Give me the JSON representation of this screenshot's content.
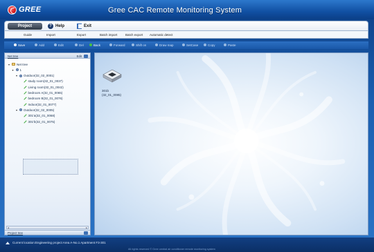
{
  "brand": {
    "logo_text": "GREE"
  },
  "window": {
    "title": "Gree CAC Remote Monitoring System"
  },
  "menubar": {
    "project": "Project",
    "help": "Help",
    "exit": "Exit"
  },
  "subbar": {
    "items": [
      "Guide",
      "Import",
      "Export",
      "Batch import",
      "Batch export",
      "Automatic detect"
    ]
  },
  "actionbar": {
    "items": [
      "Save",
      "Add",
      "Edit",
      "Del",
      "Back",
      "Forward",
      "Shift on",
      "Draw map",
      "SetCase",
      "Copy",
      "Paste"
    ]
  },
  "left_panel": {
    "header": "Net tree",
    "header_right": "Edit",
    "footer": "Project tree",
    "tree": [
      {
        "label": "Net tree",
        "level": 0,
        "icon": "folder",
        "twisty": "-"
      },
      {
        "label": "1",
        "level": 1,
        "icon": "node",
        "twisty": "-"
      },
      {
        "label": "Outdoor(32_02_0001)",
        "level": 2,
        "icon": "node",
        "twisty": "-"
      },
      {
        "label": "study room(32_01_0037)",
        "level": 3,
        "icon": "unit",
        "twisty": ""
      },
      {
        "label": "Living room(32_01_0042)",
        "level": 3,
        "icon": "unit",
        "twisty": ""
      },
      {
        "label": "bedroom A(32_01_0065)",
        "level": 3,
        "icon": "unit",
        "twisty": ""
      },
      {
        "label": "bedroom B(32_01_0076)",
        "level": 3,
        "icon": "unit",
        "twisty": ""
      },
      {
        "label": "Indoor(32_01_0077)",
        "level": 3,
        "icon": "unit",
        "twisty": ""
      },
      {
        "label": "Outdoor(32_02_0005)",
        "level": 2,
        "icon": "node",
        "twisty": "-"
      },
      {
        "label": "301'a(32_01_0068)",
        "level": 3,
        "icon": "unit",
        "twisty": ""
      },
      {
        "label": "301'b(32_01_0075)",
        "level": 3,
        "icon": "unit",
        "twisty": ""
      }
    ]
  },
  "workspace": {
    "device": {
      "name": "301b",
      "code": "(32_01_0085)"
    }
  },
  "status": {
    "location": "Current location:Engineering project Area A-No.1 Apartment F3-301",
    "copyright": "All rights reserved © Gree central air conditioner remote monitoring system"
  },
  "colors": {
    "title_bar": "#1150a3",
    "accent": "#2c6fc2",
    "logo_red": "#d3171a",
    "unit_green": "#3ca83a"
  }
}
